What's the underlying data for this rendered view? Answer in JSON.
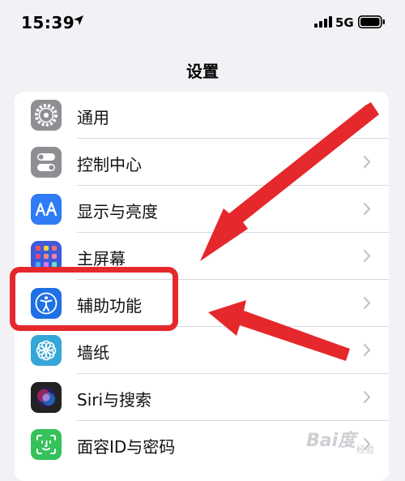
{
  "status_bar": {
    "time": "15:39",
    "network": "5G"
  },
  "nav": {
    "title": "设置"
  },
  "settings_items": [
    {
      "label": "通用",
      "icon": "gear-icon",
      "color": "#8e8e93"
    },
    {
      "label": "控制中心",
      "icon": "toggles-icon",
      "color": "#8e8e93"
    },
    {
      "label": "显示与亮度",
      "icon": "text-size-icon",
      "color": "#2f7cf6"
    },
    {
      "label": "主屏幕",
      "icon": "home-screen-icon",
      "color": "#3b5bdb"
    },
    {
      "label": "辅助功能",
      "icon": "accessibility-icon",
      "color": "#1f6fe5"
    },
    {
      "label": "墙纸",
      "icon": "flower-icon",
      "color": "#35a7d6"
    },
    {
      "label": "Siri与搜索",
      "icon": "siri-icon",
      "color": "#222222"
    },
    {
      "label": "面容ID与密码",
      "icon": "face-id-icon",
      "color": "#35c25a"
    }
  ],
  "annotation": {
    "highlight_color": "#e5282b"
  },
  "watermark": {
    "text": "Bai度",
    "sub": "经验"
  }
}
